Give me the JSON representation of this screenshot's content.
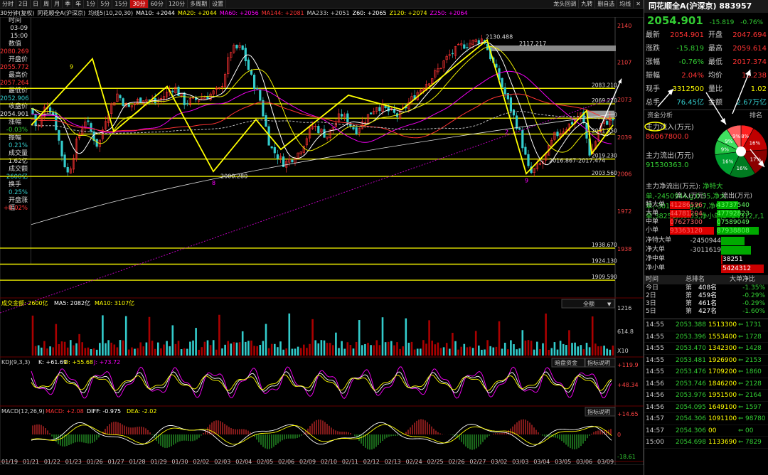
{
  "toolbar": {
    "tabs": [
      "分时",
      "2日",
      "日",
      "周",
      "月",
      "季",
      "年",
      "1分",
      "5分",
      "15分",
      "30分",
      "60分",
      "120分",
      "多周期",
      "设置"
    ],
    "active_index": 10,
    "right": [
      "龙头回调",
      "九转",
      "删自选",
      "均线"
    ]
  },
  "mainbar": {
    "period": "30分钟(复权)",
    "name": "同花顺全A(沪深京)",
    "ma": "均线5(10,20,30)",
    "ma10": "MA10: +2044",
    "ma20": "MA20: +2044",
    "ma60": "MA60: +2056",
    "ma144": "MA144: +2081",
    "ma233": "MA233: +2051",
    "z60": "Z60: +2065",
    "z120": "Z120: +2074",
    "z250": "Z250: +2064"
  },
  "left_panel": [
    {
      "k": "时间",
      "v": "03-09",
      "c": "w"
    },
    {
      "k": "",
      "v": "15:00",
      "c": "w"
    },
    {
      "k": "数值",
      "v": "2080.269",
      "c": "r"
    },
    {
      "k": "开盘价",
      "v": "2055.772",
      "c": "r"
    },
    {
      "k": "最高价",
      "v": "2057.264",
      "c": "r"
    },
    {
      "k": "最低价",
      "v": "2052.906",
      "c": "c"
    },
    {
      "k": "收盘价",
      "v": "2054.901",
      "c": "w"
    },
    {
      "k": "涨幅",
      "v": "-0.03%",
      "c": "g"
    },
    {
      "k": "振幅",
      "v": "0.21%",
      "c": "c"
    },
    {
      "k": "成交量",
      "v": "1.62亿",
      "c": "w"
    },
    {
      "k": "成交额",
      "v": "2600亿",
      "c": "c"
    },
    {
      "k": "换手",
      "v": "0.25%",
      "c": "c"
    },
    {
      "k": "开盘涨幅",
      "v": "+0.02%",
      "c": "r"
    }
  ],
  "price_axis": [
    "2140",
    "2107",
    "2073",
    "2039",
    "2006",
    "1972",
    "1938"
  ],
  "price_levels": [
    "2083.210",
    "2069.210",
    "2056.210",
    "2041.850",
    "2019.230",
    "2003.560",
    "1938.670",
    "1924.130",
    "1909.590"
  ],
  "annotations": {
    "high": "2130.488",
    "high_range": "2117.217",
    "low": "2000.280",
    "low2": "2016.867-2017.474",
    "n9a": "9",
    "n9b": "9",
    "n2": "2",
    "n8": "8"
  },
  "volume": {
    "label": "成交金额: 2600亿",
    "ma5": "MA5: 2082亿",
    "ma10": "MA10: 3107亿",
    "axis": [
      "1216",
      "614.8",
      "X10"
    ],
    "select": "全额"
  },
  "kdj": {
    "label": "KDJ(9,3,3)",
    "k": "K: +61.69",
    "d": "D: +55.68",
    "j": "J: +73.72",
    "btn1": "暗盘资金",
    "btn2": "指标说明",
    "axis": [
      "+119.9",
      "+48.34"
    ]
  },
  "macd": {
    "label": "MACD(12,26,9)",
    "macd": "MACD: +2.08",
    "diff": "DIFF: -0.975",
    "dea": "DEA: -2.02",
    "btn": "指标说明",
    "axis": [
      "+14.65",
      "0",
      "-18.61"
    ]
  },
  "dates": [
    "01/19",
    "01/21",
    "01/22",
    "01/23",
    "01/26",
    "01/27",
    "01/28",
    "01/29",
    "01/30",
    "02/02",
    "02/03",
    "02/04",
    "02/05",
    "02/06",
    "02/09",
    "02/10",
    "02/11",
    "02/12",
    "02/13",
    "02/24",
    "02/25",
    "02/26",
    "02/27",
    "03/02",
    "03/03",
    "03/04",
    "03/05",
    "03/06",
    "03/09"
  ],
  "right": {
    "title": "同花顺全A(沪深京) 883957",
    "price": "2054.901",
    "change": "-15.819",
    "pct": "-0.76%",
    "quote": [
      [
        "最新",
        "2054.901",
        "开盘",
        "2047.694"
      ],
      [
        "涨跌",
        "-15.819",
        "最高",
        "2059.614"
      ],
      [
        "涨幅",
        "-0.76%",
        "最低",
        "2017.374"
      ],
      [
        "振幅",
        "2.04%",
        "均价",
        "16.238"
      ],
      [
        "现手",
        "3312500",
        "量比",
        "1.02"
      ],
      [
        "总手",
        "76.45亿",
        "金额",
        "2.67万亿"
      ]
    ],
    "fund_tab": "资金分析",
    "rank_tab": "排名",
    "inflow_label": "主力流入(万元)",
    "inflow": "86067800.0",
    "outflow_label": "主力流出(万元)",
    "outflow": "91530363.0",
    "net_label": "主力净流出(万元):",
    "net": [
      [
        "净特大单",
        "-2450944",
        "g",
        0.55
      ],
      [
        "净大单",
        "-3011619",
        "g",
        0.7
      ],
      [
        "净中单",
        "38251",
        "r",
        0.03
      ],
      [
        "净小单",
        "5424312",
        "r",
        1
      ]
    ],
    "pie": [
      {
        "label": "8%",
        "value": 8,
        "color": "#ff2020"
      },
      {
        "label": "16%",
        "value": 16,
        "color": "#c00000"
      },
      {
        "label": "17%",
        "value": 17,
        "color": "#8b0000"
      },
      {
        "label": "16%",
        "value": 16,
        "color": "#007a20"
      },
      {
        "label": "16%",
        "value": 16,
        "color": "#00a030"
      },
      {
        "label": "9%",
        "value": 9,
        "color": "#20c040"
      },
      {
        "label": "9%",
        "value": 9,
        "color": "#40e060"
      },
      {
        "label": "9%",
        "value": 9,
        "color": "#ff6060"
      }
    ],
    "flow_head": [
      "流入(万元)",
      "流出(万元)"
    ],
    "flow": [
      [
        "特大单",
        "41286596",
        "43737540",
        0.45,
        0.48
      ],
      [
        "大单",
        "44781204",
        "47792823",
        0.49,
        0.53
      ],
      [
        "中单",
        "07627300",
        "07589049",
        0.08,
        0.08
      ],
      [
        "小单",
        "93363120",
        "87938808",
        1,
        0.95
      ]
    ],
    "rank_head": [
      "时间",
      "总排名",
      "大单净比"
    ],
    "rank": [
      [
        "今日",
        "第",
        "408名",
        "-1.35%"
      ],
      [
        "2日",
        "第",
        "459名",
        "-0.29%"
      ],
      [
        "3日",
        "第",
        "461名",
        "-0.29%"
      ],
      [
        "5日",
        "第",
        "427名",
        "-1.60%"
      ]
    ],
    "ticks": [
      [
        "14:55",
        "2053.388",
        "1513300",
        "1731"
      ],
      [
        "14:55",
        "2053.396",
        "1553400",
        "1728"
      ],
      [
        "14:55",
        "2053.470",
        "1342300",
        "1428"
      ],
      [
        "14:55",
        "2053.481",
        "1926900",
        "2153"
      ],
      [
        "14:55",
        "2053.476",
        "1709200",
        "1860"
      ],
      [
        "14:56",
        "2053.746",
        "1846200",
        "2128"
      ],
      [
        "14:56",
        "2053.976",
        "1951500",
        "2164"
      ],
      [
        "14:56",
        "2054.095",
        "1649100",
        "1597"
      ],
      [
        "14:57",
        "2054.306",
        "1091100",
        "98780"
      ],
      [
        "14:57",
        "2054.306",
        "00",
        "00"
      ],
      [
        "15:00",
        "2054.698",
        "1133690",
        "7829"
      ]
    ]
  }
}
